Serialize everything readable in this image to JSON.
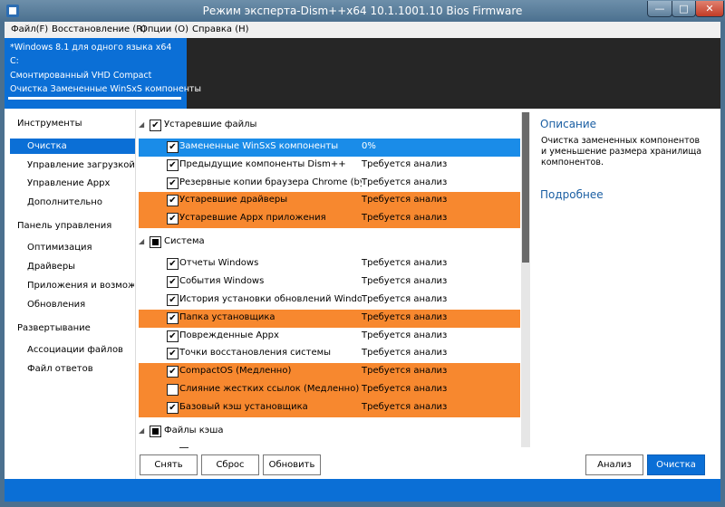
{
  "window": {
    "title": "Режим эксперта-Dism++x64 10.1.1001.10 Bios Firmware",
    "minimize_glyph": "—",
    "maximize_glyph": "□",
    "close_glyph": "✕"
  },
  "menu": [
    "Файл(F)",
    "Восстановление (R)",
    "Опции (O)",
    "Справка (H)"
  ],
  "session": {
    "os": "*Windows 8.1 для одного языка x64",
    "drive": "C:",
    "vhd": "Смонтированный VHD Compact",
    "task": "Очистка Замененные WinSxS компоненты"
  },
  "sidebar": {
    "sections": [
      {
        "title": "Инструменты",
        "items": [
          "Очистка",
          "Управление загрузкой",
          "Управление Appx",
          "Дополнительно"
        ]
      },
      {
        "title": "Панель управления",
        "items": [
          "Оптимизация",
          "Драйверы",
          "Приложения и возможности",
          "Обновления"
        ]
      },
      {
        "title": "Развертывание",
        "items": [
          "Ассоциации файлов",
          "Файл ответов"
        ]
      }
    ],
    "selected_item": "Очистка"
  },
  "groups": {
    "obsolete": "Устаревшие файлы",
    "system": "Система",
    "cache": "Файлы кэша"
  },
  "rows": [
    {
      "label": "Замененные WinSxS компоненты",
      "status": "0%",
      "checked": true
    },
    {
      "label": "Предыдущие компоненты Dism++",
      "status": "Требуется анализ",
      "checked": true
    },
    {
      "label": "Резервные копии браузера Chrome (by Honny)",
      "status": "Требуется анализ",
      "checked": true
    },
    {
      "label": "Устаревшие драйверы",
      "status": "Требуется анализ",
      "checked": true
    },
    {
      "label": "Устаревшие Appx приложения",
      "status": "Требуется анализ",
      "checked": true
    },
    {
      "label": "Отчеты Windows",
      "status": "Требуется анализ",
      "checked": true
    },
    {
      "label": "События Windows",
      "status": "Требуется анализ",
      "checked": true
    },
    {
      "label": "История установки обновлений Windows",
      "status": "Требуется анализ",
      "checked": true
    },
    {
      "label": "Папка установщика",
      "status": "Требуется анализ",
      "checked": true
    },
    {
      "label": "Поврежденные Appx",
      "status": "Требуется анализ",
      "checked": true
    },
    {
      "label": "Точки восстановления системы",
      "status": "Требуется анализ",
      "checked": true
    },
    {
      "label": "CompactOS (Медленно)",
      "status": "Требуется анализ",
      "checked": true
    },
    {
      "label": "Слияние жестких ссылок (Медленно)",
      "status": "Требуется анализ",
      "checked": false
    },
    {
      "label": "Базовый кэш установщика",
      "status": "Требуется анализ",
      "checked": true
    }
  ],
  "description": {
    "title": "Описание",
    "text": "Очистка замененных компонентов и уменьшение размера хранилища компонентов.",
    "more": "Подробнее"
  },
  "buttons": {
    "remove": "Снять",
    "reset": "Сброс",
    "refresh": "Обновить",
    "analyze": "Анализ",
    "clean": "Очистка"
  },
  "colors": {
    "accent": "#0b6fd6",
    "selection": "#1a8ce8",
    "highlight": "#f7882f",
    "title_bar": "#4b708f",
    "link": "#1b5fa3"
  },
  "icons": {
    "app": "dism-app-icon",
    "expand": "collapse-triangle-icon"
  }
}
